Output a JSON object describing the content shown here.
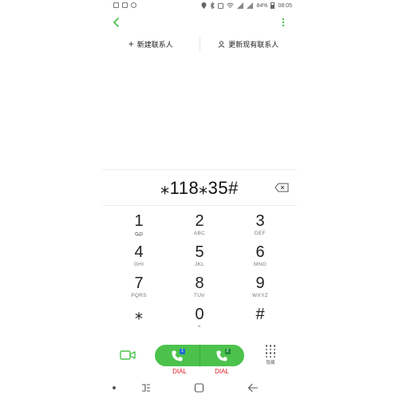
{
  "status_bar": {
    "battery": "84%",
    "time": "08:05"
  },
  "app_bar": {
    "back_icon": "back-arrow-icon",
    "more_icon": "more-vertical-icon",
    "accent_color": "#4cc24c"
  },
  "contact_actions": {
    "new_contact": "新建联系人",
    "update_existing": "更新现有联系人"
  },
  "dialer": {
    "number": "⁎118⁎35#"
  },
  "keypad": [
    {
      "digit": "1",
      "letters": ""
    },
    {
      "digit": "2",
      "letters": "ABC"
    },
    {
      "digit": "3",
      "letters": "DEF"
    },
    {
      "digit": "4",
      "letters": "GHI"
    },
    {
      "digit": "5",
      "letters": "JKL"
    },
    {
      "digit": "6",
      "letters": "MNO"
    },
    {
      "digit": "7",
      "letters": "PQRS"
    },
    {
      "digit": "8",
      "letters": "TUV"
    },
    {
      "digit": "9",
      "letters": "WXYZ"
    },
    {
      "digit": "⁎",
      "letters": ""
    },
    {
      "digit": "0",
      "letters": "+"
    },
    {
      "digit": "#",
      "letters": ""
    }
  ],
  "actions": {
    "sim1_badge": "1",
    "sim2_badge": "2",
    "dial1_label": "DIAL",
    "dial2_label": "DIAL",
    "keypad_toggle_label": "隐藏",
    "dial_color": "#4cc24c",
    "dial_label_color": "#e0202a"
  }
}
